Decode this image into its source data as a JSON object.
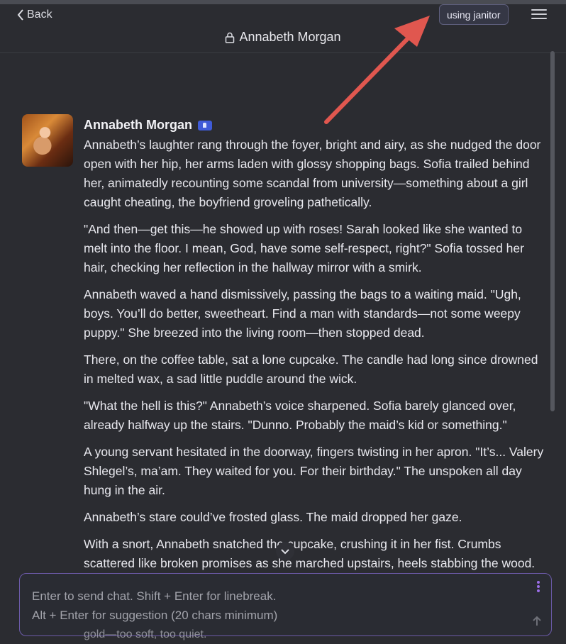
{
  "header": {
    "back_label": "Back",
    "title": "Annabeth Morgan",
    "using_button": "using janitor"
  },
  "message": {
    "author": "Annabeth Morgan",
    "paragraphs": [
      "Annabeth’s laughter rang through the foyer, bright and airy, as she nudged the door open with her hip, her arms laden with glossy shopping bags. Sofia trailed behind her, animatedly recounting some scandal from university—something about a girl caught cheating, the boyfriend groveling pathetically.",
      "\"And then—get this—he showed up with roses! Sarah looked like she wanted to melt into the floor. I mean, God, have some self-respect, right?\" Sofia tossed her hair, checking her reflection in the hallway mirror with a smirk.",
      "Annabeth waved a hand dismissively, passing the bags to a waiting maid. \"Ugh, boys. You’ll do better, sweetheart. Find a man with standards—not some weepy puppy.\" She breezed into the living room—then stopped dead.",
      "There, on the coffee table, sat a lone cupcake. The candle had long since drowned in melted wax, a sad little puddle around the wick.",
      "\"What the hell is this?\" Annabeth’s voice sharpened. Sofia barely glanced over, already halfway up the stairs. \"Dunno. Probably the maid’s kid or something.\"",
      "A young servant hesitated in the doorway, fingers twisting in her apron. \"It’s... Valery Shlegel’s, ma’am. They waited for you. For their birthday.\" The unspoken all day hung in the air.",
      "Annabeth’s stare could’ve frosted glass. The maid dropped her gaze.",
      "With a snort, Annabeth snatched the cupcake, crushing it in her fist. Crumbs scattered like broken promises as she marched upstairs, heels stabbing the wood."
    ],
    "trailing_visible": "gold—too soft, too quiet."
  },
  "composer": {
    "placeholder_line1": "Enter to send chat. Shift + Enter for linebreak.",
    "placeholder_line2": "Alt + Enter for suggestion (20 chars minimum)"
  },
  "icons": {
    "back": "chevron-left-icon",
    "lock": "lock-icon",
    "menu": "hamburger-menu-icon",
    "badge": "creator-badge-icon",
    "scroll_down": "chevron-down-icon",
    "more": "vertical-dots-icon",
    "send": "send-arrow-icon"
  },
  "colors": {
    "background": "#2b2c31",
    "accent_border": "#6b5aa8",
    "annotation_arrow": "#e0574f"
  }
}
